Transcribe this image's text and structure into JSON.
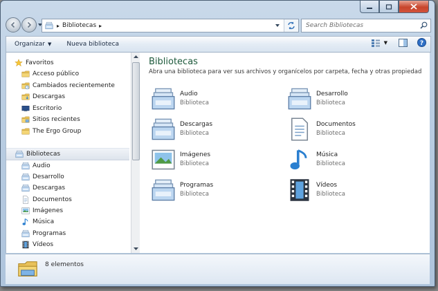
{
  "address": {
    "crumb": "Bibliotecas",
    "separator": "▸"
  },
  "search": {
    "placeholder": "Search Bibliotecas"
  },
  "toolbar": {
    "organize_label": "Organizar",
    "organize_caret": "▼",
    "new_library_label": "Nueva biblioteca",
    "views_caret": "▼"
  },
  "navpane": {
    "favorites_label": "Favoritos",
    "favorites": [
      {
        "label": "Acceso público",
        "icon": "folder-icon"
      },
      {
        "label": "Cambiados recientemente",
        "icon": "recent-folder-icon"
      },
      {
        "label": "Descargas",
        "icon": "downloads-folder-icon"
      },
      {
        "label": "Escritorio",
        "icon": "desktop-icon"
      },
      {
        "label": "Sitios recientes",
        "icon": "recent-places-icon"
      },
      {
        "label": "The Ergo Group",
        "icon": "folder-icon"
      }
    ],
    "libraries_label": "Bibliotecas",
    "libraries": [
      {
        "label": "Audio",
        "icon": "library-icon"
      },
      {
        "label": "Desarrollo",
        "icon": "library-icon"
      },
      {
        "label": "Descargas",
        "icon": "library-icon"
      },
      {
        "label": "Documentos",
        "icon": "documents-icon"
      },
      {
        "label": "Imágenes",
        "icon": "pictures-icon"
      },
      {
        "label": "Música",
        "icon": "music-icon"
      },
      {
        "label": "Programas",
        "icon": "library-icon"
      },
      {
        "label": "Vídeos",
        "icon": "videos-icon"
      }
    ]
  },
  "content": {
    "title": "Bibliotecas",
    "subtitle": "Abra una biblioteca para ver sus archivos y organícelos por carpeta, fecha y otras propiedad...",
    "libraries": [
      {
        "name": "Audio",
        "type": "Biblioteca",
        "icon": "library-icon"
      },
      {
        "name": "Desarrollo",
        "type": "Biblioteca",
        "icon": "library-icon"
      },
      {
        "name": "Descargas",
        "type": "Biblioteca",
        "icon": "library-icon"
      },
      {
        "name": "Documentos",
        "type": "Biblioteca",
        "icon": "documents-icon"
      },
      {
        "name": "Imágenes",
        "type": "Biblioteca",
        "icon": "pictures-icon"
      },
      {
        "name": "Música",
        "type": "Biblioteca",
        "icon": "music-icon"
      },
      {
        "name": "Programas",
        "type": "Biblioteca",
        "icon": "library-icon"
      },
      {
        "name": "Vídeos",
        "type": "Biblioteca",
        "icon": "videos-icon"
      }
    ]
  },
  "details": {
    "count": "8 elementos"
  },
  "colors": {
    "title_green": "#1e5a3c",
    "close_red": "#c7452c",
    "window_frame": "#b9cde2"
  }
}
